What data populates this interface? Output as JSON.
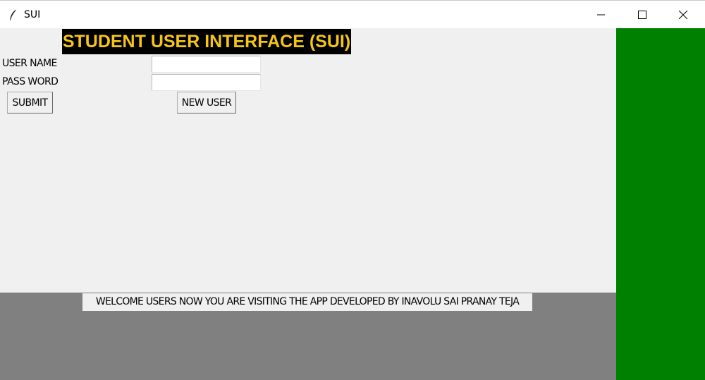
{
  "window": {
    "title": "SUI",
    "icon": "feather-icon",
    "controls": {
      "minimize": "minimize-icon",
      "maximize": "maximize-icon",
      "close": "close-icon"
    }
  },
  "form": {
    "heading": "STUDENT USER INTERFACE (SUI)",
    "username_label": "USER NAME",
    "username_value": "",
    "password_label": "PASS WORD",
    "password_value": "",
    "submit_label": "SUBMIT",
    "new_user_label": "NEW USER"
  },
  "footer": {
    "message": "WELCOME USERS NOW YOU ARE VISITING THE APP DEVELOPED BY INAVOLU SAI PRANAY TEJA"
  },
  "colors": {
    "heading_bg": "#000000",
    "heading_text": "#f5c518",
    "side_panel": "#008000",
    "bottom_band": "#808080",
    "window_bg": "#f0f0f0"
  }
}
